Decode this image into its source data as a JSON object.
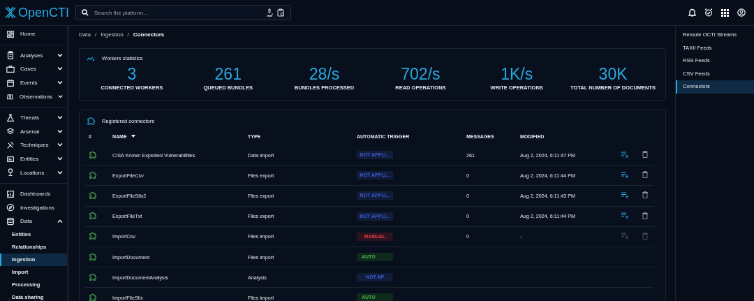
{
  "topbar": {
    "logo": "OpenCTI",
    "search": {
      "placeholder": "Search the platform..."
    }
  },
  "sidebar": {
    "sections": [
      {
        "items": [
          {
            "label": "Home",
            "kind": "link"
          }
        ]
      },
      {
        "items": [
          {
            "label": "Analyses",
            "kind": "menu",
            "expanded": false
          },
          {
            "label": "Cases",
            "kind": "menu",
            "expanded": false
          },
          {
            "label": "Events",
            "kind": "menu",
            "expanded": false
          },
          {
            "label": "Observations",
            "kind": "menu",
            "expanded": false
          }
        ]
      },
      {
        "items": [
          {
            "label": "Threats",
            "kind": "menu",
            "expanded": false
          },
          {
            "label": "Arsenal",
            "kind": "menu",
            "expanded": false
          },
          {
            "label": "Techniques",
            "kind": "menu",
            "expanded": false
          },
          {
            "label": "Entities",
            "kind": "menu",
            "expanded": false
          },
          {
            "label": "Locations",
            "kind": "menu",
            "expanded": false
          }
        ]
      },
      {
        "items": [
          {
            "label": "Dashboards",
            "kind": "link"
          },
          {
            "label": "Investigations",
            "kind": "link"
          },
          {
            "label": "Data",
            "kind": "menu",
            "expanded": true,
            "children": [
              {
                "label": "Entities",
                "selected": false
              },
              {
                "label": "Relationships",
                "selected": false
              },
              {
                "label": "Ingestion",
                "selected": true
              },
              {
                "label": "Import",
                "selected": false
              },
              {
                "label": "Processing",
                "selected": false
              },
              {
                "label": "Data sharing",
                "selected": false
              }
            ]
          }
        ]
      }
    ]
  },
  "breadcrumbs": {
    "separator": "/",
    "items": [
      "Data",
      "Ingestion",
      "Connectors"
    ]
  },
  "workers_statistics": {
    "title": "Workers statistics",
    "stats": [
      {
        "value": "3",
        "label": "CONNECTED WORKERS"
      },
      {
        "value": "261",
        "label": "QUEUED BUNDLES"
      },
      {
        "value": "28/s",
        "label": "BUNDLES PROCESSED"
      },
      {
        "value": "702/s",
        "label": "READ OPERATIONS"
      },
      {
        "value": "1K/s",
        "label": "WRITE OPERATIONS"
      },
      {
        "value": "30K",
        "label": "TOTAL NUMBER OF DOCUMENTS"
      }
    ]
  },
  "connectors": {
    "title": "Registered connectors",
    "columns": [
      "#",
      "NAME",
      "TYPE",
      "AUTOMATIC TRIGGER",
      "MESSAGES",
      "MODIFIED"
    ],
    "rows": [
      {
        "name": "CISA Known Exploited Vulnerabilities",
        "type": "Data import",
        "trigger": {
          "kind": "not_applicable",
          "text": "NOT APPLI..."
        },
        "messages": "261",
        "modified": "Aug 2, 2024, 6:11:47 PM",
        "actions_disabled": false
      },
      {
        "name": "ExportFileCsv",
        "type": "Files export",
        "trigger": {
          "kind": "not_applicable",
          "text": "NOT APPLI..."
        },
        "messages": "0",
        "modified": "Aug 2, 2024, 6:11:44 PM",
        "actions_disabled": false
      },
      {
        "name": "ExportFileStix2",
        "type": "Files export",
        "trigger": {
          "kind": "not_applicable",
          "text": "NOT APPLI..."
        },
        "messages": "0",
        "modified": "Aug 2, 2024, 6:11:43 PM",
        "actions_disabled": false
      },
      {
        "name": "ExportFileTxt",
        "type": "Files export",
        "trigger": {
          "kind": "not_applicable",
          "text": "NOT APPLI..."
        },
        "messages": "0",
        "modified": "Aug 2, 2024, 6:11:44 PM",
        "actions_disabled": false
      },
      {
        "name": "ImportCsv",
        "type": "Files import",
        "trigger": {
          "kind": "manual",
          "text": "MANUAL"
        },
        "messages": "0",
        "modified": "-",
        "actions_disabled": true
      },
      {
        "name": "ImportDocument",
        "type": "Files import",
        "trigger": {
          "kind": "automatic",
          "text": "AUTO"
        }
      },
      {
        "name": "ImportDocumentAnalysis",
        "type": "Analysis",
        "trigger": {
          "kind": "not_applicable",
          "text": "NOT AP"
        }
      },
      {
        "name": "ImportFileStix",
        "type": "Files import",
        "trigger": {
          "kind": "automatic",
          "text": "AUTO"
        }
      }
    ]
  },
  "right_nav": [
    {
      "label": "Remote OCTI Streams",
      "selected": false
    },
    {
      "label": "TAXII Feeds",
      "selected": false
    },
    {
      "label": "RSS Feeds",
      "selected": false
    },
    {
      "label": "CSV Feeds",
      "selected": false
    },
    {
      "label": "Connectors",
      "selected": true
    }
  ]
}
